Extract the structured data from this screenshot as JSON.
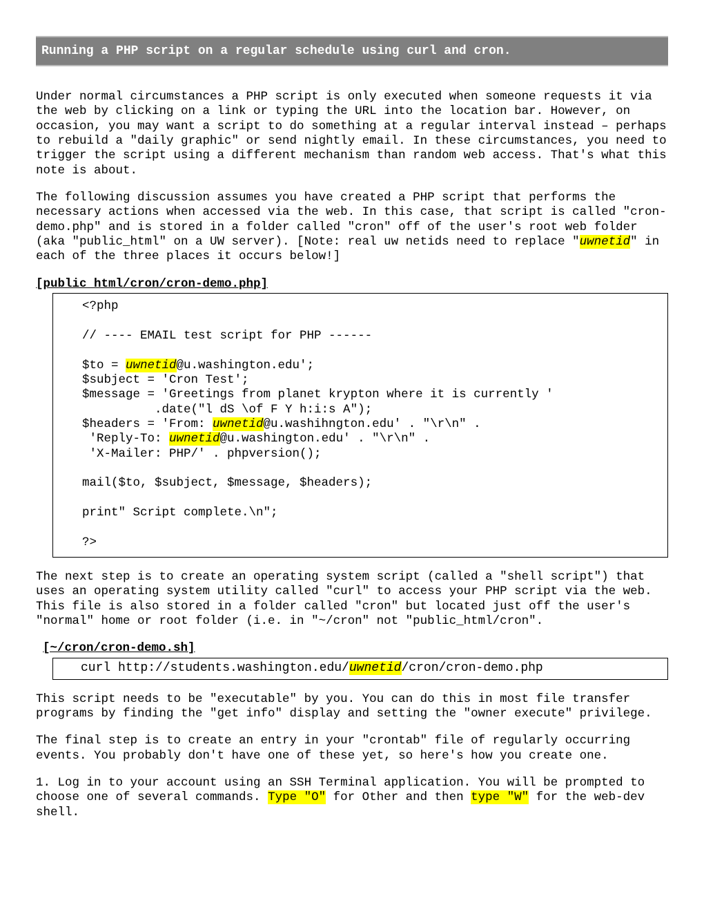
{
  "title": "Running a PHP script on a regular schedule using curl and cron.",
  "para1": "Under normal circumstances a PHP script is only executed when someone requests it via the web by clicking on a link or typing the URL into the location bar. However, on occasion, you may want a script to do something at a regular interval instead – perhaps to rebuild a \"daily graphic\" or send nightly email. In these circumstances, you need to trigger the script using a different mechanism than random web access. That's what this note is about.",
  "para2_a": "The following discussion assumes you have created a PHP script that performs the necessary actions when accessed via the web. In this case, that script is called \"cron-demo.php\" and is stored in a folder called \"cron\" off of the user's root web folder (aka \"public_html\" on a UW server). [Note: real uw netids need to replace \"",
  "uwnetid": "uwnetid",
  "para2_b": "\" in each of the three places it occurs below!]",
  "code1_title": "[public_html/cron/cron-demo.php]",
  "code1_l1": "<?php",
  "code1_l2": "// ---- EMAIL test script for PHP ------",
  "code1_l3a": "$to = ",
  "code1_l3b": "@u.washington.edu';",
  "code1_l4": "$subject = 'Cron Test';",
  "code1_l5": "$message = 'Greetings from planet krypton where it is currently '",
  "code1_l6": "          .date(\"l dS \\of F Y h:i:s A\");",
  "code1_l7a": "$headers = 'From: ",
  "code1_l7b": "@u.washihngton.edu' . \"\\r\\n\" .",
  "code1_l8a": " 'Reply-To: ",
  "code1_l8b": "@u.washington.edu' . \"\\r\\n\" .",
  "code1_l9": " 'X-Mailer: PHP/' . phpversion();",
  "code1_l10": "mail($to, $subject, $message, $headers);",
  "code1_l11": "print\" Script complete.\\n\";",
  "code1_l12": "?>",
  "para3": "The next step is to create an operating system script (called a \"shell script\") that uses an operating system utility called \"curl\" to access your PHP script via the web. This file is also stored in a folder called \"cron\" but located just off the user's \"normal\" home or root folder (i.e. in \"~/cron\" not \"public_html/cron\".",
  "code2_title": "[~/cron/cron-demo.sh]",
  "code2_a": "curl http://students.washington.edu/",
  "code2_b": "/cron/cron-demo.php",
  "para4": "This script needs to be \"executable\" by you. You can do this in most file transfer programs by finding the \"get info\" display and setting the \"owner execute\" privilege.",
  "para5": "The final step is to create an entry in your \"crontab\" file of regularly occurring events. You probably don't have one of these yet, so here's how you create one.",
  "para6_a": "1. Log in to your account using an SSH Terminal application. You will be prompted to choose one of several commands. ",
  "typeO": "Type \"O\"",
  "para6_b": " for Other and then ",
  "typeW": "type \"W\"",
  "para6_c": " for the web-dev shell."
}
